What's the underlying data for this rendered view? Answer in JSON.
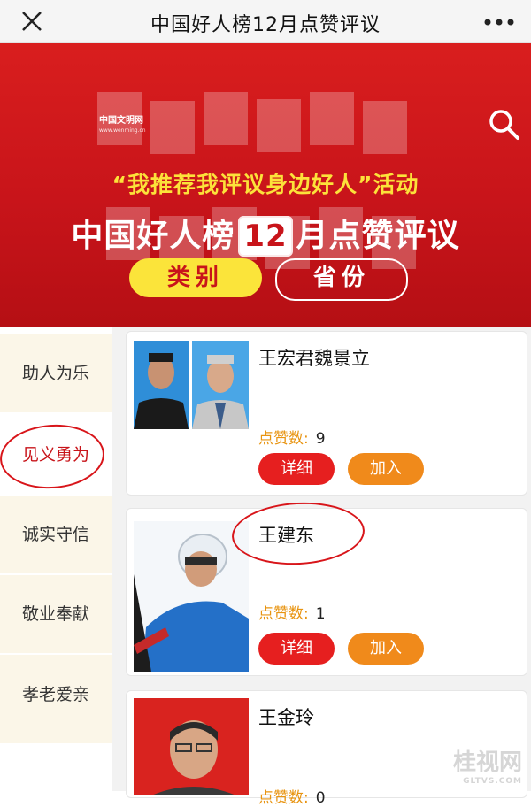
{
  "header": {
    "title": "中国好人榜12月点赞评议"
  },
  "banner": {
    "brand_name": "中国文明网",
    "brand_url": "www.wenming.cn",
    "slogan": "“我推荐我评议身边好人”活动",
    "headline_prefix": "中国好人榜",
    "headline_month": "12",
    "headline_suffix": "月点赞评议",
    "filter_category": "类别",
    "filter_province": "省份"
  },
  "sidebar": {
    "items": [
      {
        "label": "助人为乐"
      },
      {
        "label": "见义勇为"
      },
      {
        "label": "诚实守信"
      },
      {
        "label": "敬业奉献"
      },
      {
        "label": "孝老爱亲"
      }
    ],
    "active_index": 1
  },
  "cards": [
    {
      "name": "王宏君魏景立",
      "likes_label": "点赞数:",
      "likes": "9",
      "detail": "详细",
      "join": "加入"
    },
    {
      "name": "王建东",
      "likes_label": "点赞数:",
      "likes": "1",
      "detail": "详细",
      "join": "加入"
    },
    {
      "name": "王金玲",
      "likes_label": "点赞数:",
      "likes": "0"
    }
  ],
  "watermark": {
    "text": "桂视网",
    "sub": "GLTVS.COM"
  },
  "colors": {
    "brand_red": "#c8141a",
    "slogan_yellow": "#fce23a",
    "detail_red": "#e61f1f",
    "join_orange": "#f08a1b",
    "likes_orange": "#e89411"
  }
}
